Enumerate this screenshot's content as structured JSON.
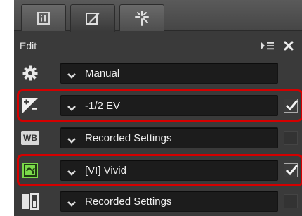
{
  "tabs": [
    {
      "name": "info-icon",
      "active": false
    },
    {
      "name": "edit-icon",
      "active": true
    },
    {
      "name": "sparkle-icon",
      "active": false
    }
  ],
  "header": {
    "title": "Edit"
  },
  "rows": [
    {
      "icon": "gear-icon",
      "value": "Manual",
      "checkbox": "none"
    },
    {
      "icon": "exposure-compensation-icon",
      "value": "-1/2 EV",
      "checkbox": "checked",
      "highlighted": true
    },
    {
      "icon": "white-balance-icon",
      "icon_text": "WB",
      "value": "Recorded Settings",
      "checkbox": "unchecked"
    },
    {
      "icon": "picture-control-icon",
      "value": "[VI] Vivid",
      "checkbox": "checked",
      "highlighted": true
    },
    {
      "icon": "active-d-lighting-icon",
      "value": "Recorded Settings",
      "checkbox": "unchecked"
    }
  ],
  "colors": {
    "highlight": "#d40000",
    "panel": "#3a3a3a",
    "picture_control": "#7ad94a"
  }
}
